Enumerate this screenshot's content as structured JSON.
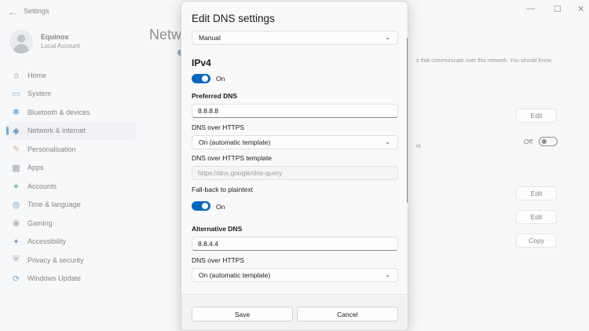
{
  "window": {
    "title": "Settings",
    "back_glyph": "←",
    "min_glyph": "—",
    "max_glyph": "☐",
    "close_glyph": "✕"
  },
  "account": {
    "name": "Equinox",
    "type": "Local Account"
  },
  "sidebar": {
    "items": [
      {
        "label": "Home",
        "icon": "home-icon",
        "glyph": "⌂",
        "color": "#1b1b1b"
      },
      {
        "label": "System",
        "icon": "system-icon",
        "glyph": "▭",
        "color": "#0078d4"
      },
      {
        "label": "Bluetooth & devices",
        "icon": "bluetooth-icon",
        "glyph": "✱",
        "color": "#0078d4"
      },
      {
        "label": "Network & internet",
        "icon": "network-icon",
        "glyph": "◆",
        "color": "#0a5ea8",
        "active": true
      },
      {
        "label": "Personalisation",
        "icon": "brush-icon",
        "glyph": "✎",
        "color": "#c86a2a"
      },
      {
        "label": "Apps",
        "icon": "apps-icon",
        "glyph": "▦",
        "color": "#4a5566"
      },
      {
        "label": "Accounts",
        "icon": "accounts-icon",
        "glyph": "●",
        "color": "#1f9e5a"
      },
      {
        "label": "Time & language",
        "icon": "globe-icon",
        "glyph": "◍",
        "color": "#1f7ab8"
      },
      {
        "label": "Gaming",
        "icon": "gaming-icon",
        "glyph": "◉",
        "color": "#7a7f86"
      },
      {
        "label": "Accessibility",
        "icon": "accessibility-icon",
        "glyph": "✦",
        "color": "#1b5fa8"
      },
      {
        "label": "Privacy & security",
        "icon": "shield-icon",
        "glyph": "⛨",
        "color": "#5a6270"
      },
      {
        "label": "Windows Update",
        "icon": "update-icon",
        "glyph": "⟳",
        "color": "#0a6cc4"
      }
    ]
  },
  "main": {
    "title": "Netw",
    "bg_text": "s that communicate over this network. You should know",
    "bg_text2": "rk",
    "buttons": {
      "edit1": "Edit",
      "edit2": "Edit",
      "edit3": "Edit",
      "copy": "Copy"
    },
    "off_label": "Off"
  },
  "dialog": {
    "title": "Edit DNS settings",
    "mode_select": "Manual",
    "section_ipv4": "IPv4",
    "ipv4_toggle_label": "On",
    "preferred_dns_label": "Preferred DNS",
    "preferred_dns_value": "8.8.8.8",
    "dns_over_https_label": "DNS over HTTPS",
    "dns_over_https_value": "On (automatic template)",
    "doh_template_label": "DNS over HTTPS template",
    "doh_template_placeholder": "https://dns.google/dns-query",
    "fallback_label": "Fall-back to plaintext",
    "fallback_toggle_label": "On",
    "alternative_dns_label": "Alternative DNS",
    "alternative_dns_value": "8.8.4.4",
    "alt_dns_over_https_label": "DNS over HTTPS",
    "alt_dns_over_https_value": "On (automatic template)",
    "save_label": "Save",
    "cancel_label": "Cancel",
    "chevron_glyph": "⌄"
  },
  "colors": {
    "accent": "#0067c0"
  }
}
